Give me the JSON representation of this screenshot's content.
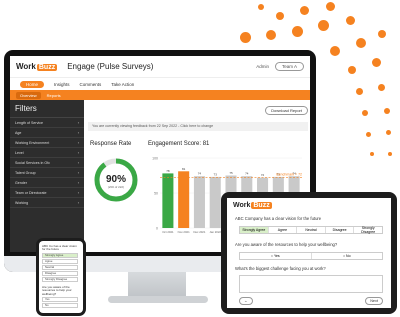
{
  "brand": {
    "logo_main": "Work",
    "logo_accent": "Buzz",
    "accent": "#f58220",
    "dark": "#2d2d2d"
  },
  "app": {
    "title": "Engage (Pulse Surveys)",
    "user_label": "Admin",
    "pill": "Team A",
    "tabs": [
      {
        "label": "Home"
      },
      {
        "label": "Insights"
      },
      {
        "label": "Comments"
      },
      {
        "label": "Take Action"
      }
    ],
    "subtabs": [
      {
        "label": "Overview"
      },
      {
        "label": "Reports"
      }
    ],
    "download_button": "Download Report",
    "notice": "You are currently viewing feedback from 22 Sep 2022 - Click here to change",
    "response_rate_title": "Response Rate",
    "response_rate_value": "90%",
    "response_rate_sub": "(200 of 222)",
    "engagement_title": "Engagement Score: 81",
    "benchmark_label": "Benchmark = 72"
  },
  "sidebar": {
    "heading": "Filters",
    "items": [
      {
        "label": "Length of Service"
      },
      {
        "label": "Age"
      },
      {
        "label": "Working Environment"
      },
      {
        "label": "Level"
      },
      {
        "label": "Social Services in Ofc"
      },
      {
        "label": "Talent Group"
      },
      {
        "label": "Gender"
      },
      {
        "label": "Team or Directorate"
      },
      {
        "label": "Working"
      }
    ]
  },
  "chart_data": {
    "type": "bar",
    "categories": [
      "Oct 2021",
      "Nov 2021",
      "Dec 2021",
      "Jan 2022",
      "Feb 2022",
      "Mar 2022",
      "Apr 2022",
      "May 2022",
      "Jun 2022"
    ],
    "values": [
      78,
      81,
      74,
      73,
      75,
      74,
      72,
      73,
      74
    ],
    "ylim": [
      0,
      100
    ],
    "benchmark": 72,
    "highlight_index": 1,
    "colors": {
      "first": "#3aa845",
      "highlight": "#f58220",
      "rest": "#c9c9c9"
    }
  },
  "tablet": {
    "logo_main": "Work",
    "logo_accent": "Buzz",
    "q1": "ABC Company has a clear vision for the future",
    "q1_options": [
      {
        "label": "Strongly Agree"
      },
      {
        "label": "Agree"
      },
      {
        "label": "Neutral"
      },
      {
        "label": "Disagree"
      },
      {
        "label": "Strongly Disagree"
      }
    ],
    "q2": "Are you aware of the resources to help your wellbeing?",
    "q2_options": [
      {
        "label": "Yes"
      },
      {
        "label": "No"
      }
    ],
    "q3": "What's the biggest challenge facing you at work?",
    "back": "←",
    "next": "Next"
  },
  "phone": {
    "q1": "ABC Co has a clear vision for the future",
    "options": [
      {
        "label": "Strongly Agree"
      },
      {
        "label": "Agree"
      },
      {
        "label": "Neutral"
      },
      {
        "label": "Disagree"
      },
      {
        "label": "Strongly Disagree"
      }
    ],
    "q2": "Are you aware of the resources to help your wellbeing?",
    "yes": "Yes",
    "no": "No"
  }
}
